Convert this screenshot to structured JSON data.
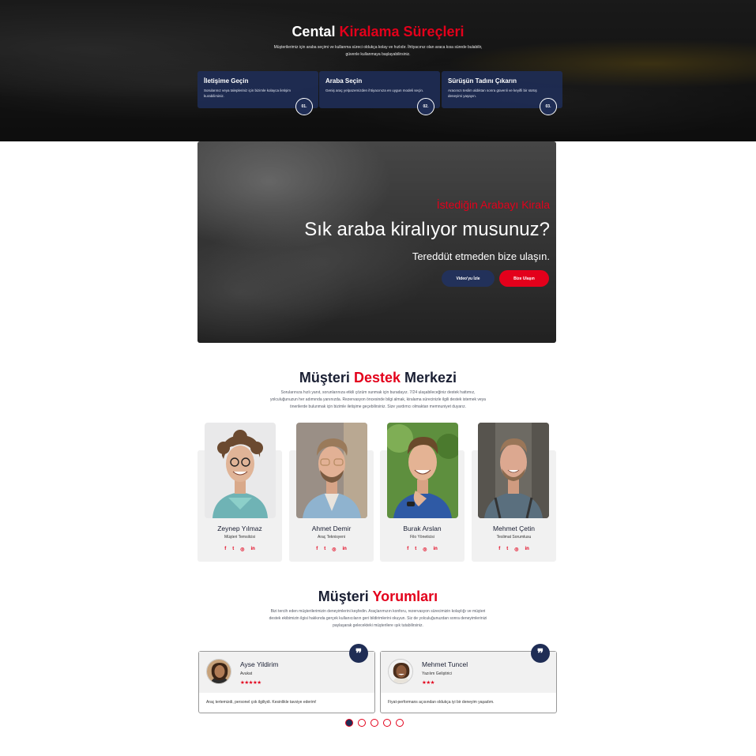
{
  "process": {
    "title_part1": "Cental",
    "title_part2": "Kiralama Süreçleri",
    "subtitle": "Müşterilerimiz için araba seçimi ve kullanma süreci oldukça kolay ve hızlıdır. İhtiyacınız olan araca kısa sürede bulabilir, güvenle kullanmaya başlayabilirsiniz.",
    "steps": [
      {
        "title": "İletişime Geçin",
        "text": "Sorularınız veya talepleriniz için bizimle kolayca iletişim kurabilirsiniz.",
        "num": "01."
      },
      {
        "title": "Araba Seçin",
        "text": "Geniş araç yelpazemizden ihtiyacınıza en uygun modeli seçin.",
        "num": "02."
      },
      {
        "title": "Sürüşün Tadını Çıkarın",
        "text": "Aracınızı teslim aldıktan sonra güvenli ve keyifli bir sürüş deneyimi yaşayın.",
        "num": "03."
      }
    ]
  },
  "banner": {
    "eyebrow": "İstediğin Arabayı Kirala",
    "headline": "Sık araba kiralıyor musunuz?",
    "sub": "Tereddüt etmeden bize ulaşın.",
    "btn_video": "Video'yu İzle",
    "btn_contact": "Bize Ulaşın"
  },
  "support": {
    "title_part1": "Müşteri",
    "title_part2": "Destek",
    "title_part3": "Merkezi",
    "desc": "Sorularınıza hızlı yanıt, sorunlarınıza etkili çözüm sunmak için buradayız. 7/24 ulaşabileceğiniz destek hattımız, yolculuğunuzun her adımında yanınızda. Rezervasyon öncesinde bilgi almak, kiralama sürecinizle ilgili destek istemek veya önerilerde bulunmak için bizimle iletişime geçebilirsiniz. Size yardımcı olmaktan memnuniyet duyarız.",
    "members": [
      {
        "name": "Zeynep Yılmaz",
        "role": "Müşteri Temsilcisi"
      },
      {
        "name": "Ahmet Demir",
        "role": "Araç Teknisyeni"
      },
      {
        "name": "Burak Arslan",
        "role": "Filo Yöneticisi"
      },
      {
        "name": "Mehmet Çetin",
        "role": "Teslimat Sorumlusu"
      }
    ],
    "social": {
      "facebook": "f",
      "twitter": "t",
      "instagram": "◎",
      "linkedin": "in"
    }
  },
  "reviews": {
    "title_part1": "Müşteri",
    "title_part2": "Yorumları",
    "desc": "Bizi tercih eden müşterilerimizin deneyimlerini keşfedin. Araçlarımızın konforu, rezervasyon sürecimizin kolaylığı ve müşteri destek ekibimizin ilgisi hakkında gerçek kullanıcıların geri bildirimlerini okuyun. Siz de yolculuğunuzdan sonra deneyimlerinizi paylaşarak gelecekteki müşterilere ışık tutabilirsiniz.",
    "items": [
      {
        "name": "Ayse Yildirim",
        "role": "Avukat",
        "stars": "★★★★★",
        "text": "Araç tertemizdi, personel çok ilgiliydi. Kesinlikle tavsiye ederim!"
      },
      {
        "name": "Mehmet Tuncel",
        "role": "Yazılım Geliştirici",
        "stars": "★★★",
        "text": "Fiyat-performans açısından oldukça iyi bir deneyim yaşadım."
      }
    ],
    "quote_icon": "quote-icon",
    "active_dot": 1,
    "dot_count": 5
  },
  "colors": {
    "accent": "#e3001b",
    "navy": "#1f2d55",
    "text": "#1a1f33"
  }
}
